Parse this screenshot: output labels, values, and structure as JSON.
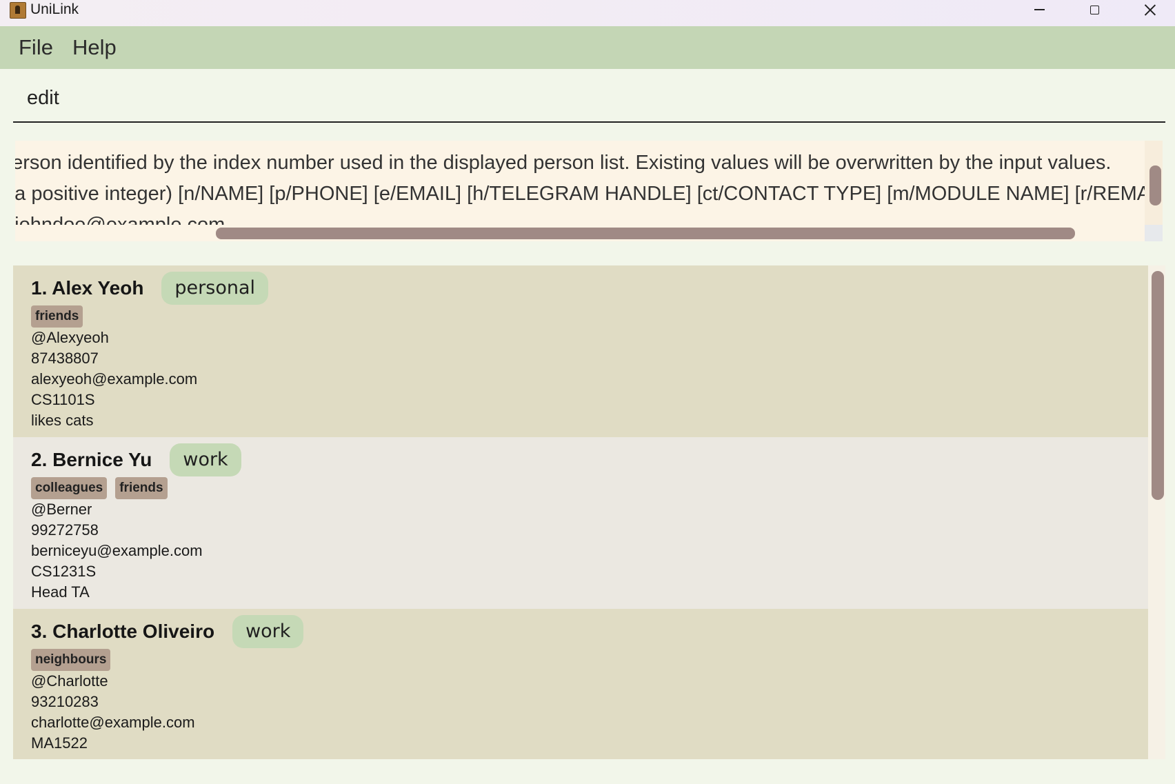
{
  "window": {
    "title": "UniLink",
    "app_icon": "address-book-icon",
    "controls": [
      "minimize-icon",
      "maximize-icon",
      "close-icon"
    ]
  },
  "menu": {
    "file": "File",
    "help": "Help"
  },
  "command_box": {
    "value": "edit"
  },
  "result_display": {
    "lines": [
      "person identified by the index number used in the displayed person list. Existing values will be overwritten by the input values.",
      "e a positive integer) [n/NAME] [p/PHONE] [e/EMAIL] [h/TELEGRAM HANDLE] [ct/CONTACT TYPE] [m/MODULE NAME] [r/REMARK]",
      "e/johndoe@example.com"
    ]
  },
  "persons": [
    {
      "name": "1. Alex Yeoh",
      "contact_type": "personal",
      "tags": [
        "friends"
      ],
      "fields": [
        "@Alexyeoh",
        "87438807",
        "alexyeoh@example.com",
        "CS1101S",
        "likes cats"
      ]
    },
    {
      "name": "2. Bernice Yu",
      "contact_type": "work",
      "tags": [
        "colleagues",
        "friends"
      ],
      "fields": [
        "@Berner",
        "99272758",
        "berniceyu@example.com",
        "CS1231S",
        "Head TA"
      ]
    },
    {
      "name": "3. Charlotte Oliveiro",
      "contact_type": "work",
      "tags": [
        "neighbours"
      ],
      "fields": [
        "@Charlotte",
        "93210283",
        "charlotte@example.com",
        "MA1522",
        ""
      ]
    }
  ],
  "colors": {
    "menubar": "#c4d6b5",
    "card_odd": "#e0dcc4",
    "card_even": "#ebe8e1",
    "contact_type_badge": "#c5d9b6",
    "tag": "#b4a090",
    "scroll_thumb": "#a08a85"
  }
}
